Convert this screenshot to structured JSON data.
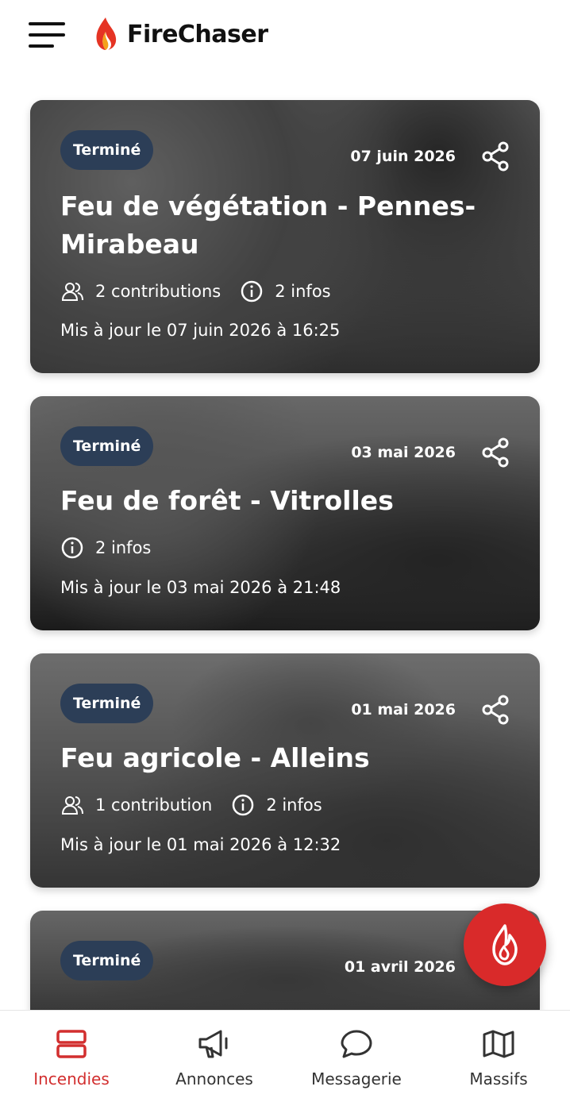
{
  "app": {
    "title": "FireChaser"
  },
  "colors": {
    "accent": "#d22f2f",
    "badge": "#2c3e57"
  },
  "incidents": [
    {
      "status": "Terminé",
      "date": "07 juin 2026",
      "title": "Feu de végétation - Pennes-Mirabeau",
      "contributions": "2 contributions",
      "infos": "2 infos",
      "updated": "Mis à jour le 07 juin 2026 à 16:25"
    },
    {
      "status": "Terminé",
      "date": "03 mai 2026",
      "title": "Feu de forêt - Vitrolles",
      "infos": "2 infos",
      "updated": "Mis à jour le 03 mai 2026 à 21:48"
    },
    {
      "status": "Terminé",
      "date": "01 mai 2026",
      "title": "Feu agricole - Alleins",
      "contributions": "1 contribution",
      "infos": "2 infos",
      "updated": "Mis à jour le 01 mai 2026 à 12:32"
    },
    {
      "status": "Terminé",
      "date": "01 avril 2026"
    }
  ],
  "nav": {
    "tabs": [
      {
        "label": "Incendies",
        "icon": "rows-icon",
        "active": true
      },
      {
        "label": "Annonces",
        "icon": "megaphone-icon",
        "active": false
      },
      {
        "label": "Messagerie",
        "icon": "chat-icon",
        "active": false
      },
      {
        "label": "Massifs",
        "icon": "map-icon",
        "active": false
      }
    ]
  },
  "fab": {
    "icon": "flame-icon"
  }
}
